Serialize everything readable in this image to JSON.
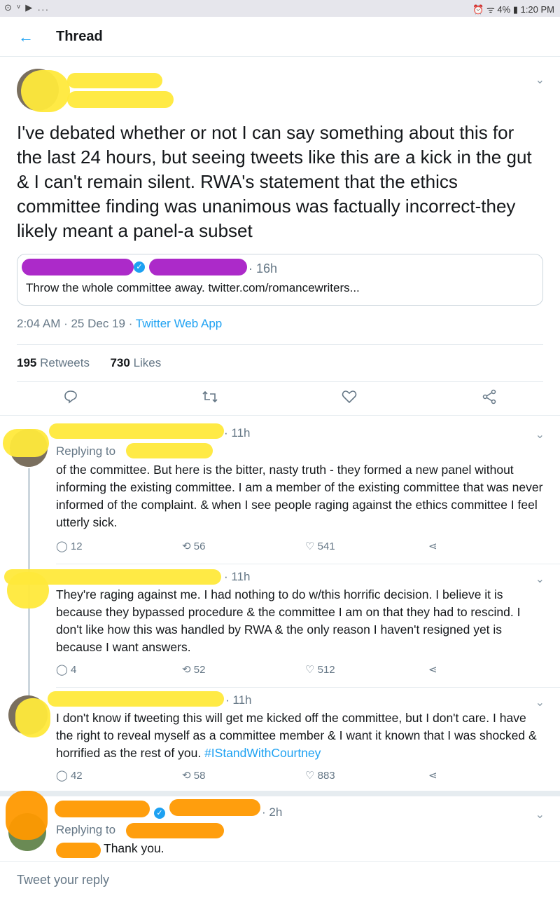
{
  "status": {
    "left_icons": "⊙ ᵛ ▶ ...",
    "right": "⏰ ᯤ 4% ▮ 1:20 PM"
  },
  "header": {
    "title": "Thread"
  },
  "main_tweet": {
    "text": "I've debated whether or not I can say something about this for the last 24 hours, but seeing tweets like this are a kick in the gut & I can't remain silent. RWA's statement that the ethics committee finding was unanimous was factually incorrect-they likely meant a panel-a subset",
    "quote": {
      "time": "· 16h",
      "text": "Throw the whole committee away. twitter.com/romancewriters..."
    },
    "timestamp": "2:04 AM · 25 Dec 19 · ",
    "source": "Twitter Web App",
    "retweets_count": "195",
    "retweets_label": "Retweets",
    "likes_count": "730",
    "likes_label": "Likes"
  },
  "replies": [
    {
      "time": "· 11h",
      "replying": "Replying to",
      "text": "of the committee. But here is the bitter, nasty truth - they formed a new panel without informing the existing committee. I am a member of the existing committee that was never informed of the complaint. & when I see people raging against the ethics committee I feel utterly sick.",
      "comments": "12",
      "retweets": "56",
      "likes": "541"
    },
    {
      "time": "· 11h",
      "text": "They're raging against me. I had nothing to do w/this horrific decision. I believe it is because they bypassed procedure & the committee I am on that they had to rescind. I don't like how this was handled by RWA & the only reason I haven't resigned yet is because I want answers.",
      "comments": "4",
      "retweets": "52",
      "likes": "512"
    },
    {
      "time": "· 11h",
      "text_main": "I don't know if tweeting this will get me kicked off the committee, but I don't care. I have the right to reveal myself as a committee member & I want it known that I was shocked & horrified as the rest of you. ",
      "hashtag": "#IStandWithCourtney",
      "comments": "42",
      "retweets": "58",
      "likes": "883"
    },
    {
      "time": "· 2h",
      "replying": "Replying to",
      "text": "Thank you."
    }
  ],
  "composer": {
    "placeholder": "Tweet your reply"
  },
  "colors": {
    "accent": "#1da1f2",
    "muted": "#657786"
  }
}
